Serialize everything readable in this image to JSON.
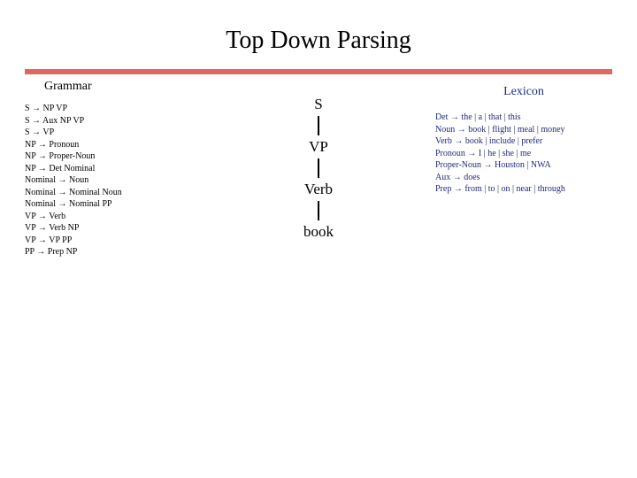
{
  "title": "Top Down Parsing",
  "grammar": {
    "heading": "Grammar",
    "rules": [
      "S → NP VP",
      "S → Aux NP VP",
      "S → VP",
      "NP → Pronoun",
      "NP → Proper-Noun",
      "NP → Det Nominal",
      "Nominal → Noun",
      "Nominal → Nominal Noun",
      "Nominal → Nominal PP",
      "VP → Verb",
      "VP → Verb NP",
      "VP → VP PP",
      "PP → Prep NP"
    ]
  },
  "lexicon": {
    "heading": "Lexicon",
    "rules": [
      "Det → the | a | that | this",
      "Noun → book | flight | meal | money",
      "Verb → book | include | prefer",
      "Pronoun → I | he | she | me",
      "Proper-Noun → Houston | NWA",
      "Aux → does",
      "Prep → from | to | on | near | through"
    ]
  },
  "tree": {
    "n0": "S",
    "n1": "VP",
    "n2": "Verb",
    "n3": "book"
  }
}
